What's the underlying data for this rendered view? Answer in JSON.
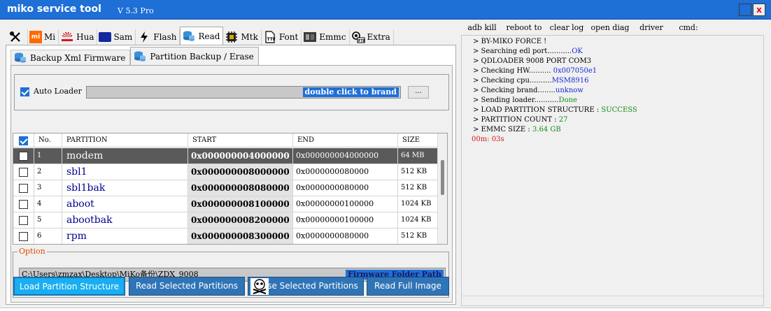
{
  "window": {
    "title": "miko service tool",
    "version": "V 5.3 Pro",
    "close_glyph": "X"
  },
  "tabs": [
    {
      "label": "",
      "icon": "tools-icon"
    },
    {
      "label": "Mi",
      "icon": "xiaomi-icon"
    },
    {
      "label": "Hua",
      "icon": "huawei-icon"
    },
    {
      "label": "Sam",
      "icon": "samsung-icon"
    },
    {
      "label": "Flash",
      "icon": "lightning-icon"
    },
    {
      "label": "Read",
      "icon": "database-icon"
    },
    {
      "label": "Mtk",
      "icon": "chip-icon"
    },
    {
      "label": "Font",
      "icon": "font-file-icon"
    },
    {
      "label": "Emmc",
      "icon": "emmc-icon"
    },
    {
      "label": "Extra",
      "icon": "extra-icon"
    }
  ],
  "active_tab": "Read",
  "subtabs": [
    {
      "label": "Backup Xml Firmware"
    },
    {
      "label": "Partition Backup / Erase"
    }
  ],
  "autoloader": {
    "label": "Auto Loader",
    "checked": true,
    "hint": "double click to brand",
    "browse_label": "..."
  },
  "table": {
    "headers": [
      "No.",
      "PARTITION",
      "START",
      "END",
      "SIZE"
    ],
    "rows": [
      {
        "no": "1",
        "partition": "modem",
        "start": "0x000000004000000",
        "end": "0x000000004000000",
        "size": "64 MB",
        "selected": true
      },
      {
        "no": "2",
        "partition": "sbl1",
        "start": "0x000000008000000",
        "end": "0x0000000080000",
        "size": "512 KB"
      },
      {
        "no": "3",
        "partition": "sbl1bak",
        "start": "0x000000008080000",
        "end": "0x0000000080000",
        "size": "512 KB"
      },
      {
        "no": "4",
        "partition": "aboot",
        "start": "0x000000008100000",
        "end": "0x00000000100000",
        "size": "1024 KB"
      },
      {
        "no": "5",
        "partition": "abootbak",
        "start": "0x000000008200000",
        "end": "0x00000000100000",
        "size": "1024 KB"
      },
      {
        "no": "6",
        "partition": "rpm",
        "start": "0x000000008300000",
        "end": "0x0000000080000",
        "size": "512 KB"
      }
    ]
  },
  "option": {
    "legend": "Option",
    "path": "C:\\Users\\zmzax\\Desktop\\MiKo备份\\ZDX_9008",
    "path_hint": "Firmware Folder Path"
  },
  "actions": {
    "load": "Load Partition Structure",
    "read_selected": "Read Selected Partitions",
    "erase_selected": "se Selected Partitions",
    "read_full": "Read Full Image"
  },
  "right_toolbar": [
    "adb kill",
    "reboot to",
    "clear log",
    "open diag",
    "driver",
    "cmd:"
  ],
  "log": [
    {
      "text": "> BY-MIKO FORCE !",
      "value": ""
    },
    {
      "text": "> Searching edl port...........",
      "value": "OK",
      "color": "blue"
    },
    {
      "text": "> QDLOADER 9008 PORT COM3",
      "value": ""
    },
    {
      "text": "> Checking HW..........",
      "value": " 0x007050e1",
      "color": "blue"
    },
    {
      "text": "> Checking cpu..........",
      "value": "MSM8916",
      "color": "blue"
    },
    {
      "text": "> Checking brand........",
      "value": "unknow",
      "color": "blue"
    },
    {
      "text": "> Sending loader...........",
      "value": "Done",
      "color": "green"
    },
    {
      "text": "> LOAD PARTITION  STRUCTURE  :  ",
      "value": "SUCCESS",
      "color": "green"
    },
    {
      "text": "> PARTITION COUNT  :  ",
      "value": "27",
      "color": "green"
    },
    {
      "text": "> EMMC SIZE   :  ",
      "value": "3.64 GB",
      "color": "green"
    },
    {
      "text": "",
      "value": "00m: 03s",
      "color": "red"
    }
  ],
  "colors": {
    "title_bar": "#1e6fd6",
    "accent_blue": "#2f74b6",
    "selected_row": "#5a5a5a",
    "log_green": "#168a16",
    "log_blue": "#1428d8",
    "log_red": "#d41a1a"
  }
}
